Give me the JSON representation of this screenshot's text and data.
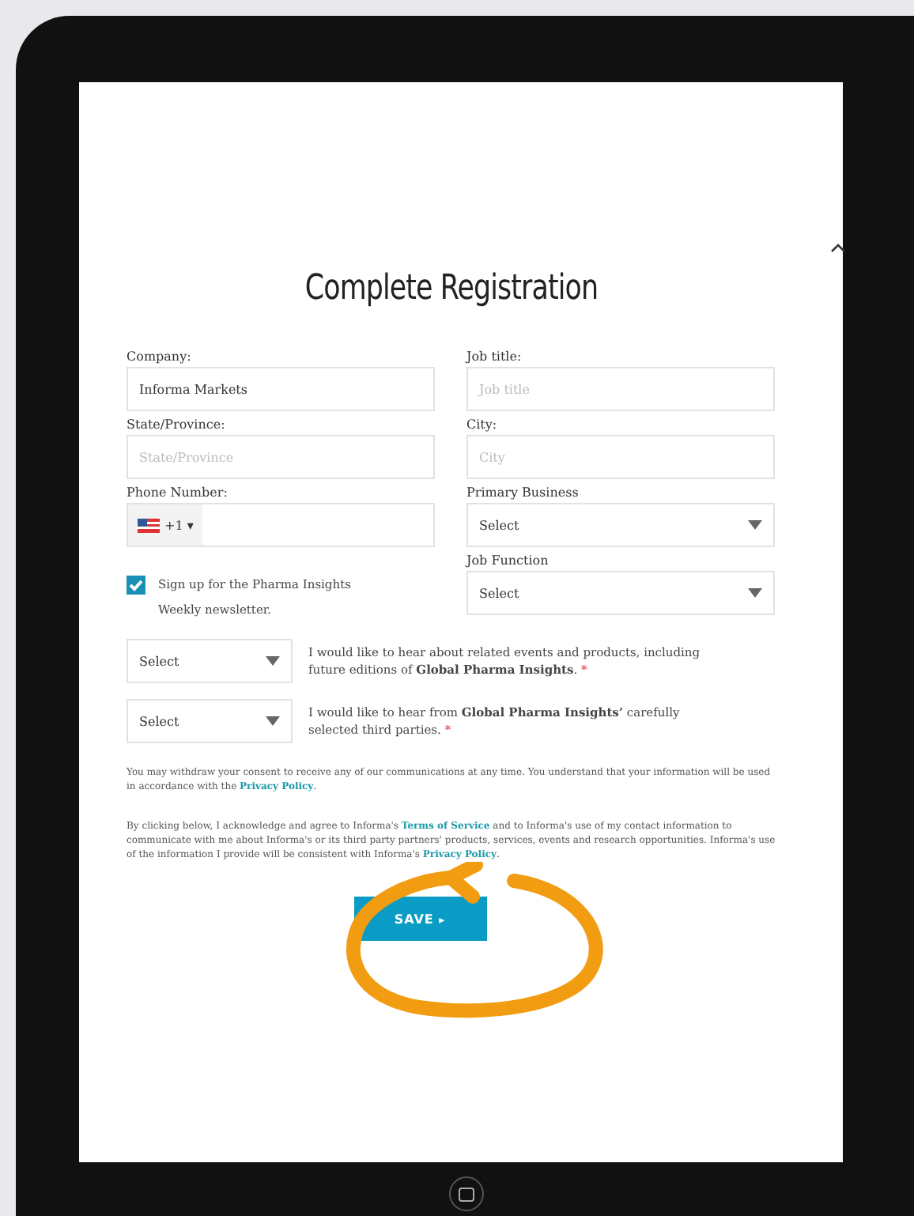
{
  "title": "Complete Registration",
  "fields": [
    {
      "kind": "text",
      "label": "Company:",
      "value": "Informa Markets"
    },
    {
      "kind": "text",
      "label": "Job title:",
      "placeholder": "Job title"
    },
    {
      "kind": "text",
      "label": "State/Province:",
      "placeholder": "State/Province"
    },
    {
      "kind": "text",
      "label": "City:",
      "placeholder": "City"
    },
    {
      "kind": "phone",
      "label": "Phone Number:",
      "code": "+1 ▾"
    },
    {
      "kind": "select",
      "label": "Primary Business",
      "value": "Select"
    }
  ],
  "newsletter": {
    "checked": true,
    "label": "Sign up for the Pharma Insights Weekly newsletter."
  },
  "job_function": {
    "label": "Job Function",
    "value": "Select"
  },
  "consents": [
    {
      "value": "Select",
      "text": "I would like to hear about related events and products, including future editions of **Global Pharma Insights**.",
      "required": "*"
    },
    {
      "value": "Select",
      "text": "I would like to hear from **Global Pharma Insights’** carefully selected third parties.",
      "required": "*"
    }
  ],
  "withdraw": {
    "text": "You may withdraw your consent to receive any of our communications at any time. You understand that your information will be used in accordance with the",
    "link": "Privacy Policy",
    "end": "."
  },
  "terms": {
    "before": "By clicking below, I acknowledge and agree to Informa's",
    "link": "Terms of Service",
    "after": "and to Informa's use of my contact information to communicate with me about Informa's or its third party partners' products, services, events and research opportunities. Informa's use of the information I provide will be consistent with Informa's",
    "link2": "Privacy Policy",
    "end": "."
  },
  "save_button": {
    "label": "SAVE",
    "icon": "▸"
  }
}
